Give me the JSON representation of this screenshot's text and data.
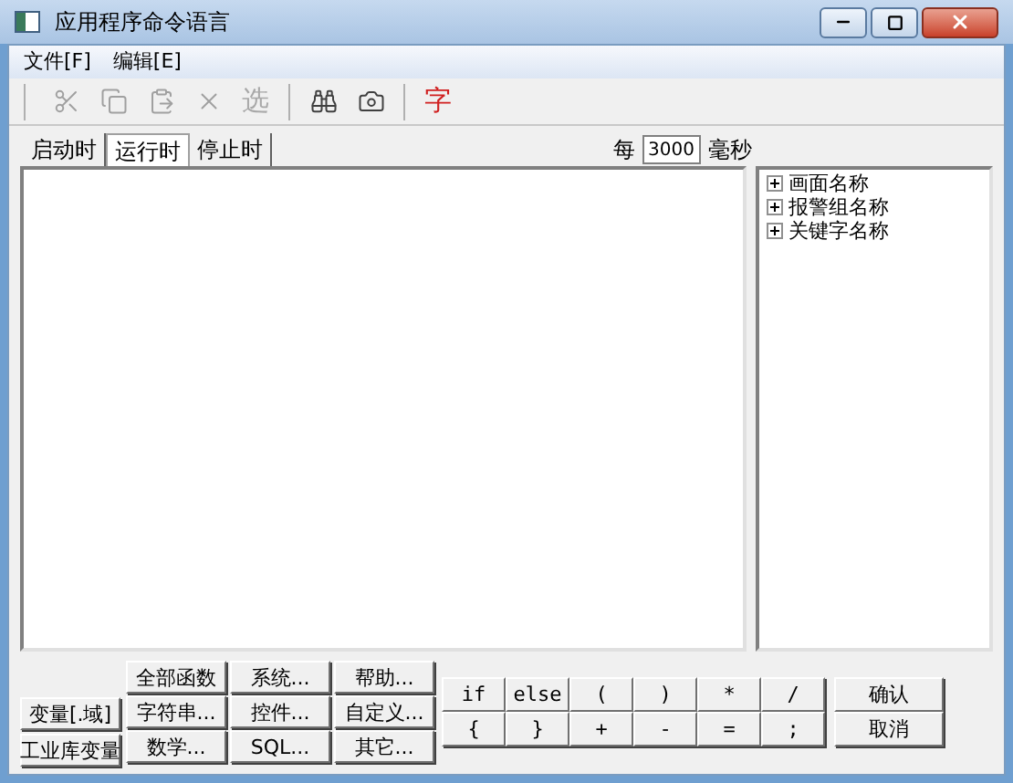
{
  "window": {
    "title": "应用程序命令语言"
  },
  "menu": [
    {
      "label": "文件[F]"
    },
    {
      "label": "编辑[E]"
    }
  ],
  "toolbar": [
    {
      "kind": "cut",
      "disabled": true
    },
    {
      "kind": "copy",
      "disabled": true
    },
    {
      "kind": "paste",
      "disabled": true
    },
    {
      "kind": "delete",
      "disabled": true
    },
    {
      "kind": "text",
      "label": "选",
      "disabled": true
    },
    {
      "kind": "separator"
    },
    {
      "kind": "find",
      "disabled": false
    },
    {
      "kind": "replace",
      "disabled": false
    },
    {
      "kind": "separator"
    },
    {
      "kind": "text",
      "label": "字",
      "disabled": false
    }
  ],
  "tabs": [
    {
      "label": "启动时",
      "selected": false
    },
    {
      "label": "运行时",
      "selected": true
    },
    {
      "label": "停止时",
      "selected": false
    }
  ],
  "interval": {
    "prefix": "每",
    "value": "3000",
    "unit": "毫秒"
  },
  "tree": [
    {
      "label": "画面名称",
      "expanded": false
    },
    {
      "label": "报警组名称",
      "expanded": false
    },
    {
      "label": "关键字名称",
      "expanded": false
    }
  ],
  "variable_buttons": [
    "变量[.域]",
    "工业库变量"
  ],
  "function_buttons": [
    [
      "全部函数",
      "系统...",
      "帮助..."
    ],
    [
      "字符串...",
      "控件...",
      "自定义..."
    ],
    [
      "数学...",
      "SQL...",
      "其它..."
    ]
  ],
  "operators": [
    [
      "if",
      "else",
      "(",
      ")",
      "*",
      "/"
    ],
    [
      "{",
      "}",
      "+",
      "-",
      "=",
      ";"
    ]
  ],
  "dialog_buttons": [
    "确认",
    "取消"
  ]
}
